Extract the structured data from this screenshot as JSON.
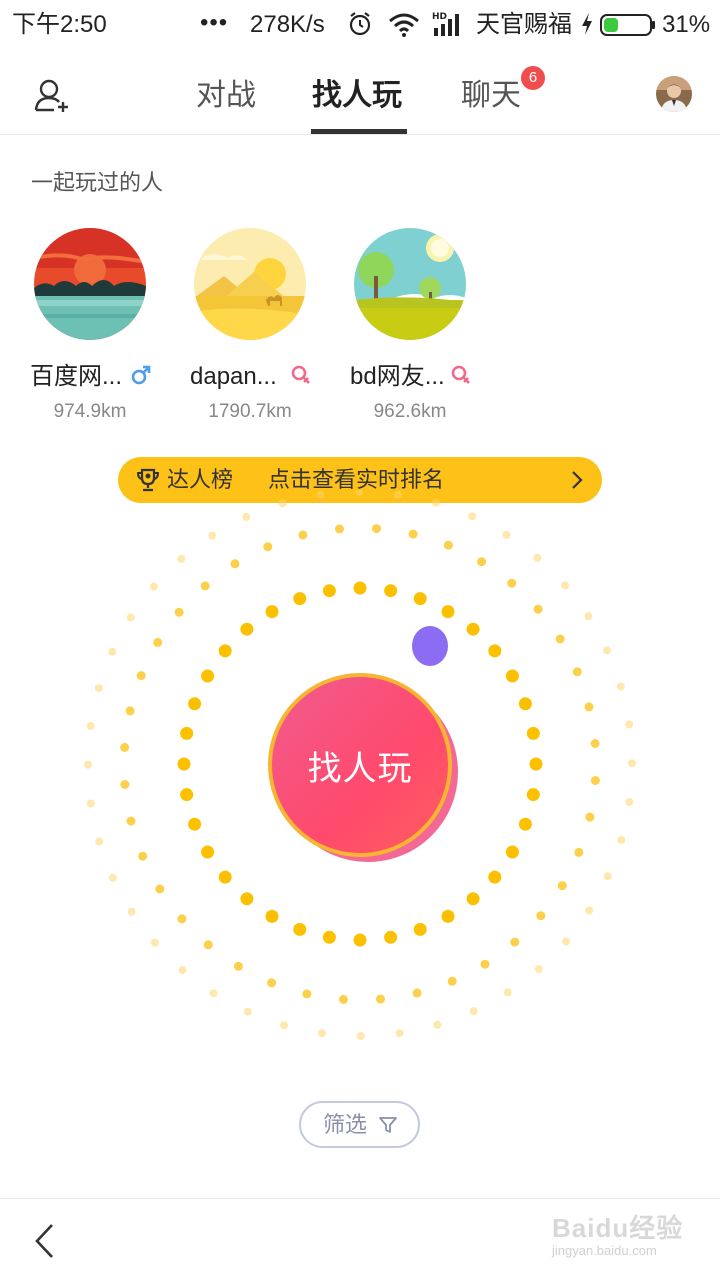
{
  "status_bar": {
    "time": "下午2:50",
    "dots": "•••",
    "speed": "278K/s",
    "carrier": "天官赐福",
    "battery_level": 0.31,
    "battery": "31%",
    "icons": [
      "alarm-icon",
      "wifi-icon",
      "hd-signal-icon",
      "charging-icon",
      "battery-icon"
    ]
  },
  "nav": {
    "add_friend_icon": "add-friend-icon",
    "tabs": [
      {
        "label": "对战"
      },
      {
        "label": "找人玩",
        "active": true
      },
      {
        "label": "聊天",
        "badge": "6"
      }
    ],
    "avatar_icon": "profile-avatar"
  },
  "played_with": {
    "title": "一起玩过的人",
    "players": [
      {
        "name": "百度网...",
        "gender": "male",
        "distance": "974.9km"
      },
      {
        "name": "dapan...",
        "gender": "female",
        "distance": "1790.7km"
      },
      {
        "name": "bd网友...",
        "gender": "female",
        "distance": "962.6km"
      }
    ]
  },
  "ranking": {
    "title": "达人榜",
    "subtitle": "点击查看实时排名",
    "icon": "trophy-icon"
  },
  "main": {
    "find_button": "找人玩"
  },
  "filter": {
    "label": "筛选",
    "icon": "filter-icon"
  },
  "bottom": {
    "back_icon": "back-arrow-icon",
    "watermark": "Baidu经验",
    "watermark_sub": "jingyan.baidu.com"
  },
  "colors": {
    "accent_yellow": "#fdc117",
    "find_pink": "#ff4a6c",
    "badge_red": "#f04e4e",
    "male_blue": "#4a9eea",
    "female_pink": "#f06a8a"
  }
}
